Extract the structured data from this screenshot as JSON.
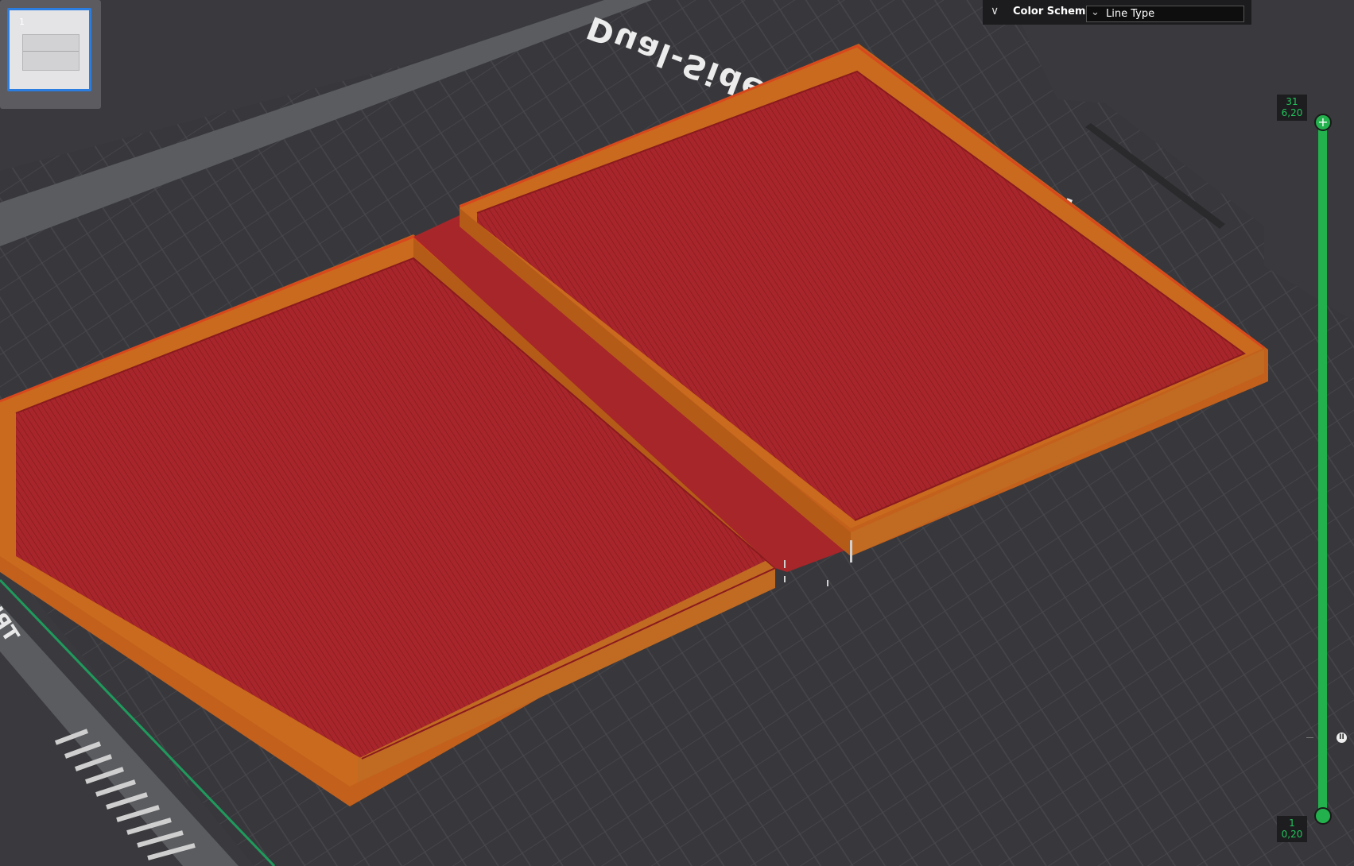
{
  "plate": {
    "brand_text": "Dual-Sided Textured PEI Pl",
    "corner_text": "TPU/PC",
    "colors": {
      "bed": "#3b3b3f",
      "grid": "#4a4a4f",
      "model_top": "#a0252a",
      "model_wall": "#c96a1e"
    }
  },
  "thumbnail_panel": {
    "plate_number": "1"
  },
  "color_scheme": {
    "label": "Color Scheme",
    "value": "Line Type",
    "icon": "double-chevron-down-icon"
  },
  "layer_slider": {
    "top_layer": "31",
    "top_height": "6,20",
    "bottom_layer": "1",
    "bottom_height": "0,20",
    "top_handle_symbol": "+",
    "pause_symbol": "II",
    "accent": "#22b14c"
  }
}
